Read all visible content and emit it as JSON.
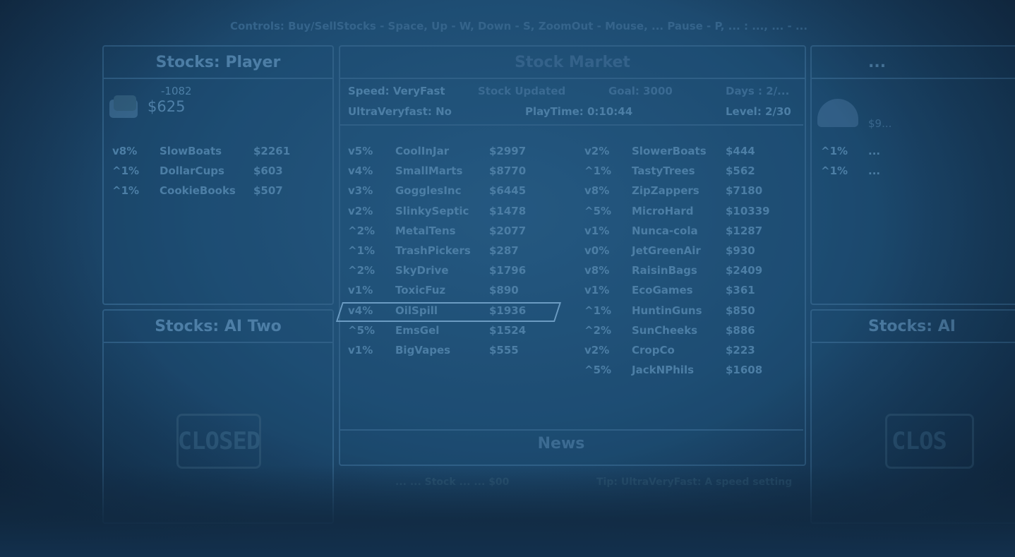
{
  "controls_text": "Controls: Buy/SellStocks - Space, Up - W, Down - S, ZoomOut - Mouse, ... Pause - P, ... : ..., ... - ...",
  "player": {
    "title": "Stocks: Player",
    "debt": "-1082",
    "cash": "$625",
    "stocks": [
      {
        "change": "v8%",
        "name": "SlowBoats",
        "price": "$2261"
      },
      {
        "change": "^1%",
        "name": "DollarCups",
        "price": "$603"
      },
      {
        "change": "^1%",
        "name": "CookieBooks",
        "price": "$507"
      }
    ]
  },
  "market": {
    "title": "Stock Market",
    "speed": "Speed: VeryFast",
    "stock_updated": "Stock Updated",
    "goal": "Goal: 3000",
    "days": "Days : 2/...",
    "ultra": "UltraVeryfast: No",
    "playtime": "PlayTime: 0:10:44",
    "level": "Level: 2/30",
    "left_stocks": [
      {
        "change": "v5%",
        "name": "CoolInJar",
        "price": "$2997"
      },
      {
        "change": "v4%",
        "name": "SmallMarts",
        "price": "$8770"
      },
      {
        "change": "v3%",
        "name": "GogglesInc",
        "price": "$6445"
      },
      {
        "change": "v2%",
        "name": "SlinkySeptic",
        "price": "$1478"
      },
      {
        "change": "^2%",
        "name": "MetalTens",
        "price": "$2077"
      },
      {
        "change": "^1%",
        "name": "TrashPickers",
        "price": "$287"
      },
      {
        "change": "^2%",
        "name": "SkyDrive",
        "price": "$1796"
      },
      {
        "change": "v1%",
        "name": "ToxicFuz",
        "price": "$890"
      },
      {
        "change": "v4%",
        "name": "OilSpill",
        "price": "$1936"
      },
      {
        "change": "^5%",
        "name": "EmsGel",
        "price": "$1524"
      },
      {
        "change": "v1%",
        "name": "BigVapes",
        "price": "$555"
      }
    ],
    "right_stocks": [
      {
        "change": "v2%",
        "name": "SlowerBoats",
        "price": "$444"
      },
      {
        "change": "^1%",
        "name": "TastyTrees",
        "price": "$562"
      },
      {
        "change": "v8%",
        "name": "ZipZappers",
        "price": "$7180"
      },
      {
        "change": "^5%",
        "name": "MicroHard",
        "price": "$10339"
      },
      {
        "change": "v1%",
        "name": "Nunca-cola",
        "price": "$1287"
      },
      {
        "change": "v0%",
        "name": "JetGreenAir",
        "price": "$930"
      },
      {
        "change": "v8%",
        "name": "RaisinBags",
        "price": "$2409"
      },
      {
        "change": "v1%",
        "name": "EcoGames",
        "price": "$361"
      },
      {
        "change": "^1%",
        "name": "HuntinGuns",
        "price": "$850"
      },
      {
        "change": "^2%",
        "name": "SunCheeks",
        "price": "$886"
      },
      {
        "change": "v2%",
        "name": "CropCo",
        "price": "$223"
      },
      {
        "change": "^5%",
        "name": "JackNPhils",
        "price": "$1608"
      }
    ],
    "news_title": "News",
    "news_left": "... ... Stock ... ... $00",
    "news_right": "Tip: UltraVeryFast: A speed setting"
  },
  "ai_one": {
    "title": "...",
    "cash": "$9...",
    "stocks": [
      {
        "change": "^1%",
        "name": "..."
      },
      {
        "change": "^1%",
        "name": "..."
      }
    ]
  },
  "ai_two": {
    "title": "Stocks: AI Two",
    "stamp": "CLOSED"
  },
  "ai_three": {
    "title": "Stocks: AI",
    "stamp": "CLOS"
  }
}
